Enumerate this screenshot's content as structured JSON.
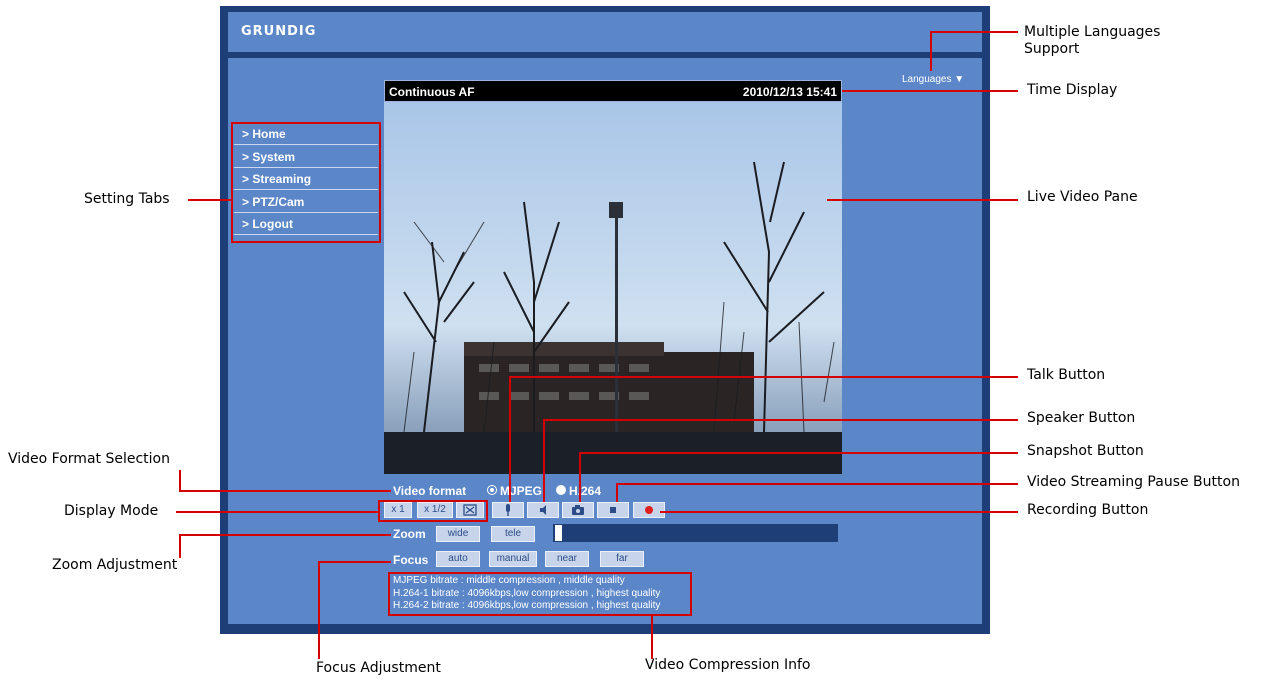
{
  "header": {
    "brand": "GRUNDIG"
  },
  "languages_label": "Languages ▼",
  "nav": {
    "items": [
      {
        "label": "> Home"
      },
      {
        "label": "> System"
      },
      {
        "label": "> Streaming"
      },
      {
        "label": "> PTZ/Cam"
      },
      {
        "label": "> Logout"
      }
    ]
  },
  "video": {
    "mode_text": "Continuous AF",
    "timestamp": "2010/12/13 15:41"
  },
  "controls": {
    "video_format_label": "Video format",
    "format_options": [
      "MJPEG",
      "H.264"
    ],
    "selected_format": "MJPEG",
    "display_modes": [
      "x 1",
      "x 1/2"
    ],
    "zoom_label": "Zoom",
    "zoom_buttons": [
      "wide",
      "tele"
    ],
    "zoom_level": 0.0,
    "focus_label": "Focus",
    "focus_buttons": [
      "auto",
      "manual",
      "near",
      "far"
    ]
  },
  "compression_info": [
    "MJPEG bitrate : middle compression , middle quality",
    "H.264-1 bitrate : 4096kbps,low compression , highest quality",
    "H.264-2 bitrate : 4096kbps,low compression , highest quality"
  ],
  "annotations": {
    "multiple_languages": [
      "Multiple Languages",
      "Support"
    ],
    "time_display": "Time Display",
    "setting_tabs": "Setting Tabs",
    "live_video_pane": "Live Video Pane",
    "talk_button": "Talk Button",
    "speaker_button": "Speaker Button",
    "snapshot_button": "Snapshot Button",
    "video_format_selection": "Video Format Selection",
    "pause_button": "Video Streaming Pause Button",
    "display_mode": "Display Mode",
    "recording_button": "Recording Button",
    "zoom_adjustment": "Zoom Adjustment",
    "focus_adjustment": "Focus Adjustment",
    "video_compression_info": "Video Compression Info"
  },
  "colors": {
    "annotation": "#d40000",
    "panel": "#5b86c8",
    "frame": "#1d3e77"
  }
}
